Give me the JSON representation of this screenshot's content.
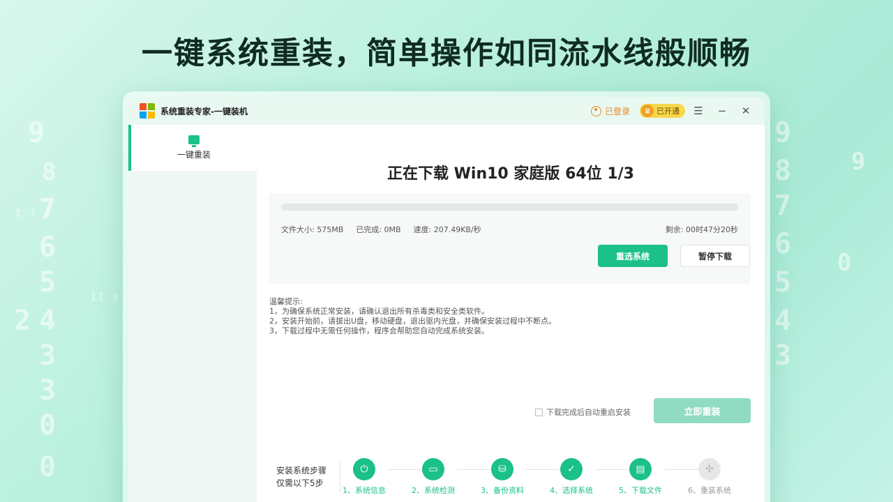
{
  "headline": "一键系统重装，简单操作如同流水线般顺畅",
  "window": {
    "title": "系统重装专家-一键装机",
    "login_label": "已登录",
    "vip_label": "已开通"
  },
  "sidebar": {
    "items": [
      {
        "label": "一键重装"
      }
    ]
  },
  "download": {
    "title": "正在下载 Win10 家庭版 64位 1/3",
    "progress": 0,
    "file_size": "文件大小: 575MB",
    "completed": "已完成: 0MB",
    "speed": "速度: 207.49KB/秒",
    "remaining": "剩余: 00时47分20秒",
    "reselect_label": "重选系统",
    "pause_label": "暂停下载"
  },
  "tips": {
    "title": "温馨提示:",
    "lines": [
      "1，为确保系统正常安装，请确认退出所有杀毒类和安全类软件。",
      "2，安装开始前，请拔出U盘，移动硬盘，退出驱内光盘，并确保安装过程中不断点。",
      "3，下载过程中无需任何操作，程序会帮助您自动完成系统安装。"
    ]
  },
  "auto_restart_label": "下载完成后自动重启安装",
  "install_now_label": "立即重装",
  "steps": {
    "header_line1": "安装系统步骤",
    "header_line2": "仅需以下5步",
    "items": [
      {
        "label": "1、系统信息",
        "icon": "power-icon",
        "done": true
      },
      {
        "label": "2、系统检测",
        "icon": "monitor-icon",
        "done": true
      },
      {
        "label": "3、备份资料",
        "icon": "drive-icon",
        "done": true
      },
      {
        "label": "4、选择系统",
        "icon": "shield-check-icon",
        "done": true
      },
      {
        "label": "5、下载文件",
        "icon": "file-icon",
        "done": true
      },
      {
        "label": "6、重装系统",
        "icon": "windows-icon",
        "done": false
      }
    ]
  },
  "colors": {
    "accent": "#1bc08a",
    "accent_disabled": "#8fdcc3",
    "vip": "#f7d84a",
    "login": "#e48a1c"
  }
}
